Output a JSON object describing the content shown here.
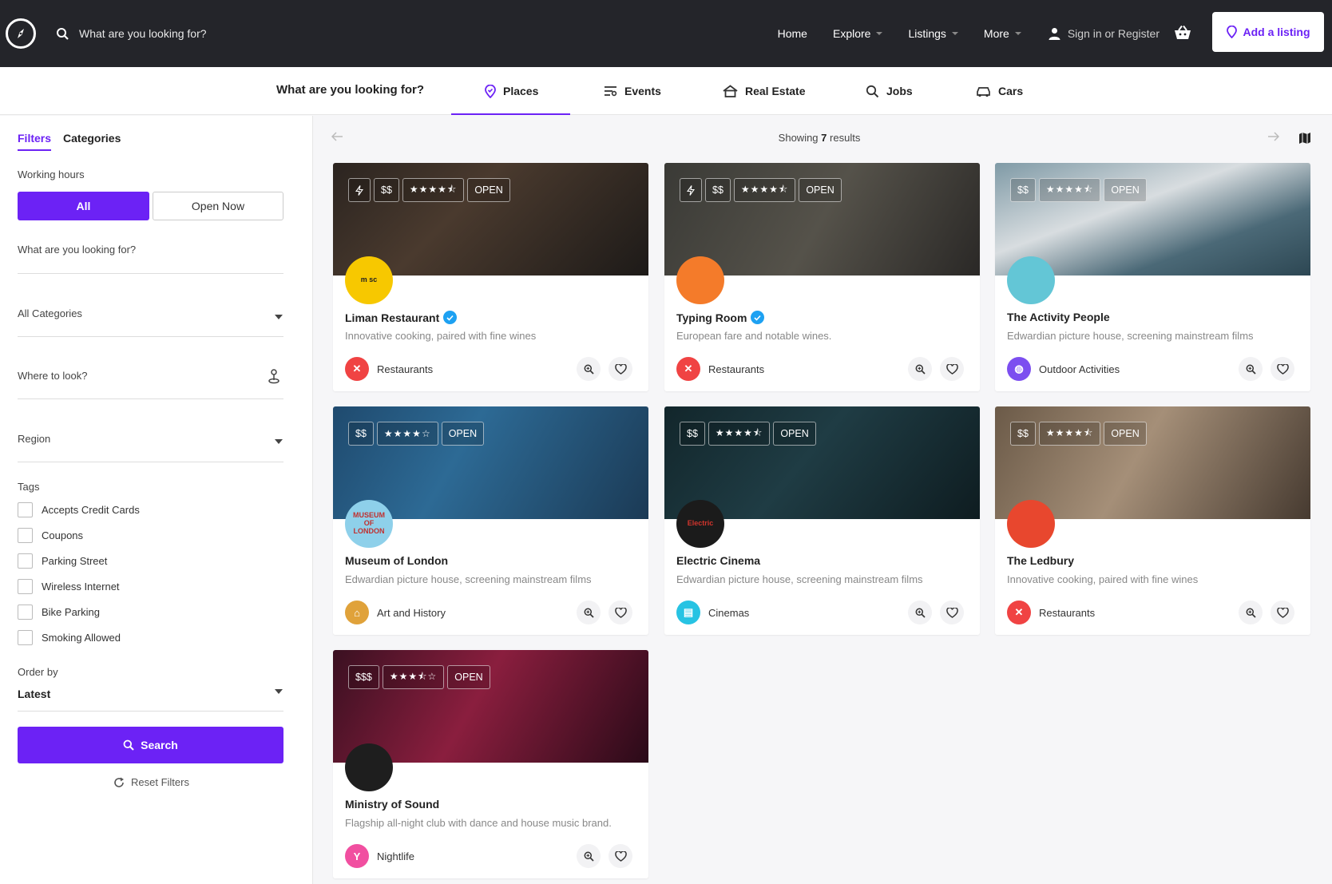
{
  "header": {
    "search_placeholder": "What are you looking for?",
    "nav": [
      {
        "label": "Home"
      },
      {
        "label": "Explore"
      },
      {
        "label": "Listings"
      },
      {
        "label": "More"
      }
    ],
    "signin_label": "Sign in or Register",
    "add_listing_label": "Add a listing"
  },
  "tabs": {
    "question": "What are you looking for?",
    "items": [
      {
        "label": "Places"
      },
      {
        "label": "Events"
      },
      {
        "label": "Real Estate"
      },
      {
        "label": "Jobs"
      },
      {
        "label": "Cars"
      }
    ]
  },
  "sidebar": {
    "tab_filters": "Filters",
    "tab_categories": "Categories",
    "working_hours_label": "Working hours",
    "hours_all": "All",
    "hours_open_now": "Open Now",
    "keyword_placeholder": "What are you looking for?",
    "category_select": "All Categories",
    "where_placeholder": "Where to look?",
    "region_select": "Region",
    "tags_label": "Tags",
    "tags": [
      {
        "label": "Accepts Credit Cards"
      },
      {
        "label": "Coupons"
      },
      {
        "label": "Parking Street"
      },
      {
        "label": "Wireless Internet"
      },
      {
        "label": "Bike Parking"
      },
      {
        "label": "Smoking Allowed"
      }
    ],
    "order_label": "Order by",
    "order_value": "Latest",
    "search_label": "Search",
    "reset_label": "Reset Filters"
  },
  "results": {
    "prefix": "Showing",
    "count": "7",
    "suffix": "results"
  },
  "colors": {
    "accent": "#6c22f5",
    "topbar": "#24252a"
  },
  "listings": [
    {
      "title": "Liman Restaurant",
      "desc": "Innovative cooking, paired with fine wines",
      "category": "Restaurants",
      "price": "$$",
      "stars": "★★★★⯪",
      "status": "OPEN",
      "featured": true,
      "verified": true,
      "avatar_text": "m sc",
      "cat_icon": "utensils-icon"
    },
    {
      "title": "Typing Room",
      "desc": "European fare and notable wines.",
      "category": "Restaurants",
      "price": "$$",
      "stars": "★★★★⯪",
      "status": "OPEN",
      "featured": true,
      "verified": true,
      "avatar_text": "",
      "cat_icon": "utensils-icon"
    },
    {
      "title": "The Activity People",
      "desc": "Edwardian picture house, screening mainstream films",
      "category": "Outdoor Activities",
      "price": "$$",
      "stars": "★★★★⯪",
      "status": "OPEN",
      "featured": false,
      "verified": false,
      "avatar_text": "",
      "cat_icon": "globe-icon"
    },
    {
      "title": "Museum of London",
      "desc": "Edwardian picture house, screening mainstream films",
      "category": "Art and History",
      "price": "$$",
      "stars": "★★★★☆",
      "status": "OPEN",
      "featured": false,
      "verified": false,
      "avatar_text": "MUSEUM OF LONDON",
      "cat_icon": "museum-icon"
    },
    {
      "title": "Electric Cinema",
      "desc": "Edwardian picture house, screening mainstream films",
      "category": "Cinemas",
      "price": "$$",
      "stars": "★★★★⯪",
      "status": "OPEN",
      "featured": false,
      "verified": false,
      "avatar_text": "Electric",
      "cat_icon": "film-icon"
    },
    {
      "title": "The Ledbury",
      "desc": "Innovative cooking, paired with fine wines",
      "category": "Restaurants",
      "price": "$$",
      "stars": "★★★★⯪",
      "status": "OPEN",
      "featured": false,
      "verified": false,
      "avatar_text": "",
      "cat_icon": "utensils-icon"
    },
    {
      "title": "Ministry of Sound",
      "desc": "Flagship all-night club with dance and house music brand.",
      "category": "Nightlife",
      "price": "$$$",
      "stars": "★★★⯪☆",
      "status": "OPEN",
      "featured": false,
      "verified": false,
      "avatar_text": "",
      "cat_icon": "cocktail-icon"
    }
  ]
}
